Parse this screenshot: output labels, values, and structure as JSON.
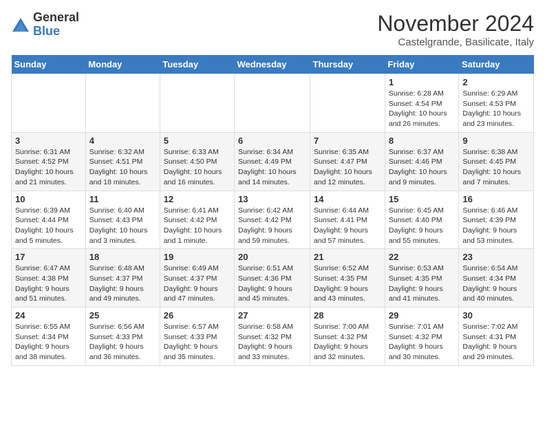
{
  "header": {
    "logo_general": "General",
    "logo_blue": "Blue",
    "month_title": "November 2024",
    "location": "Castelgrande, Basilicate, Italy"
  },
  "days_of_week": [
    "Sunday",
    "Monday",
    "Tuesday",
    "Wednesday",
    "Thursday",
    "Friday",
    "Saturday"
  ],
  "weeks": [
    [
      {
        "day": "",
        "info": ""
      },
      {
        "day": "",
        "info": ""
      },
      {
        "day": "",
        "info": ""
      },
      {
        "day": "",
        "info": ""
      },
      {
        "day": "",
        "info": ""
      },
      {
        "day": "1",
        "info": "Sunrise: 6:28 AM\nSunset: 4:54 PM\nDaylight: 10 hours and 26 minutes."
      },
      {
        "day": "2",
        "info": "Sunrise: 6:29 AM\nSunset: 4:53 PM\nDaylight: 10 hours and 23 minutes."
      }
    ],
    [
      {
        "day": "3",
        "info": "Sunrise: 6:31 AM\nSunset: 4:52 PM\nDaylight: 10 hours and 21 minutes."
      },
      {
        "day": "4",
        "info": "Sunrise: 6:32 AM\nSunset: 4:51 PM\nDaylight: 10 hours and 18 minutes."
      },
      {
        "day": "5",
        "info": "Sunrise: 6:33 AM\nSunset: 4:50 PM\nDaylight: 10 hours and 16 minutes."
      },
      {
        "day": "6",
        "info": "Sunrise: 6:34 AM\nSunset: 4:49 PM\nDaylight: 10 hours and 14 minutes."
      },
      {
        "day": "7",
        "info": "Sunrise: 6:35 AM\nSunset: 4:47 PM\nDaylight: 10 hours and 12 minutes."
      },
      {
        "day": "8",
        "info": "Sunrise: 6:37 AM\nSunset: 4:46 PM\nDaylight: 10 hours and 9 minutes."
      },
      {
        "day": "9",
        "info": "Sunrise: 6:38 AM\nSunset: 4:45 PM\nDaylight: 10 hours and 7 minutes."
      }
    ],
    [
      {
        "day": "10",
        "info": "Sunrise: 6:39 AM\nSunset: 4:44 PM\nDaylight: 10 hours and 5 minutes."
      },
      {
        "day": "11",
        "info": "Sunrise: 6:40 AM\nSunset: 4:43 PM\nDaylight: 10 hours and 3 minutes."
      },
      {
        "day": "12",
        "info": "Sunrise: 6:41 AM\nSunset: 4:42 PM\nDaylight: 10 hours and 1 minute."
      },
      {
        "day": "13",
        "info": "Sunrise: 6:42 AM\nSunset: 4:42 PM\nDaylight: 9 hours and 59 minutes."
      },
      {
        "day": "14",
        "info": "Sunrise: 6:44 AM\nSunset: 4:41 PM\nDaylight: 9 hours and 57 minutes."
      },
      {
        "day": "15",
        "info": "Sunrise: 6:45 AM\nSunset: 4:40 PM\nDaylight: 9 hours and 55 minutes."
      },
      {
        "day": "16",
        "info": "Sunrise: 6:46 AM\nSunset: 4:39 PM\nDaylight: 9 hours and 53 minutes."
      }
    ],
    [
      {
        "day": "17",
        "info": "Sunrise: 6:47 AM\nSunset: 4:38 PM\nDaylight: 9 hours and 51 minutes."
      },
      {
        "day": "18",
        "info": "Sunrise: 6:48 AM\nSunset: 4:37 PM\nDaylight: 9 hours and 49 minutes."
      },
      {
        "day": "19",
        "info": "Sunrise: 6:49 AM\nSunset: 4:37 PM\nDaylight: 9 hours and 47 minutes."
      },
      {
        "day": "20",
        "info": "Sunrise: 6:51 AM\nSunset: 4:36 PM\nDaylight: 9 hours and 45 minutes."
      },
      {
        "day": "21",
        "info": "Sunrise: 6:52 AM\nSunset: 4:35 PM\nDaylight: 9 hours and 43 minutes."
      },
      {
        "day": "22",
        "info": "Sunrise: 6:53 AM\nSunset: 4:35 PM\nDaylight: 9 hours and 41 minutes."
      },
      {
        "day": "23",
        "info": "Sunrise: 6:54 AM\nSunset: 4:34 PM\nDaylight: 9 hours and 40 minutes."
      }
    ],
    [
      {
        "day": "24",
        "info": "Sunrise: 6:55 AM\nSunset: 4:34 PM\nDaylight: 9 hours and 38 minutes."
      },
      {
        "day": "25",
        "info": "Sunrise: 6:56 AM\nSunset: 4:33 PM\nDaylight: 9 hours and 36 minutes."
      },
      {
        "day": "26",
        "info": "Sunrise: 6:57 AM\nSunset: 4:33 PM\nDaylight: 9 hours and 35 minutes."
      },
      {
        "day": "27",
        "info": "Sunrise: 6:58 AM\nSunset: 4:32 PM\nDaylight: 9 hours and 33 minutes."
      },
      {
        "day": "28",
        "info": "Sunrise: 7:00 AM\nSunset: 4:32 PM\nDaylight: 9 hours and 32 minutes."
      },
      {
        "day": "29",
        "info": "Sunrise: 7:01 AM\nSunset: 4:32 PM\nDaylight: 9 hours and 30 minutes."
      },
      {
        "day": "30",
        "info": "Sunrise: 7:02 AM\nSunset: 4:31 PM\nDaylight: 9 hours and 29 minutes."
      }
    ]
  ]
}
